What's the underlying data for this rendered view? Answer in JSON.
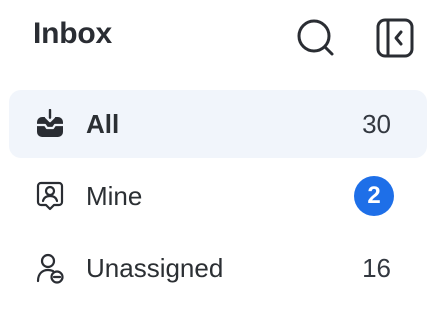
{
  "header": {
    "title": "Inbox",
    "search_icon": "search-icon",
    "collapse_icon": "collapse-sidebar-icon"
  },
  "nav": {
    "items": [
      {
        "label": "All",
        "count": "30",
        "icon": "inbox-tray-icon",
        "active": true
      },
      {
        "label": "Mine",
        "count": "2",
        "icon": "user-badge-icon",
        "active": false,
        "count_style": "badge"
      },
      {
        "label": "Unassigned",
        "count": "16",
        "icon": "user-unassigned-icon",
        "active": false
      }
    ]
  },
  "colors": {
    "accent": "#1e6fe8",
    "active_bg": "#f1f5fb",
    "text": "#2b2f33"
  }
}
